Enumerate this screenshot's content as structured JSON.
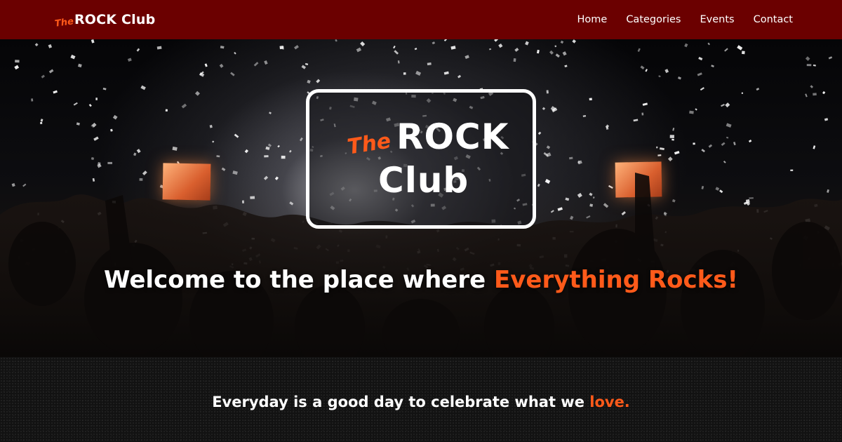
{
  "header": {
    "brand": {
      "the": "The",
      "name": "ROCK Club"
    },
    "nav": [
      "Home",
      "Categories",
      "Events",
      "Contact"
    ]
  },
  "hero": {
    "logo": {
      "the": "The",
      "rock": "ROCK",
      "club": "Club"
    },
    "headline": {
      "text": "Welcome to the place where ",
      "accent": "Everything Rocks!"
    }
  },
  "band": {
    "tagline": {
      "text": "Everyday is a good day to celebrate what we ",
      "accent": "love."
    }
  },
  "colors": {
    "header_bg": "#6b0000",
    "accent": "#ff5a1a",
    "band_bg": "#121212"
  }
}
